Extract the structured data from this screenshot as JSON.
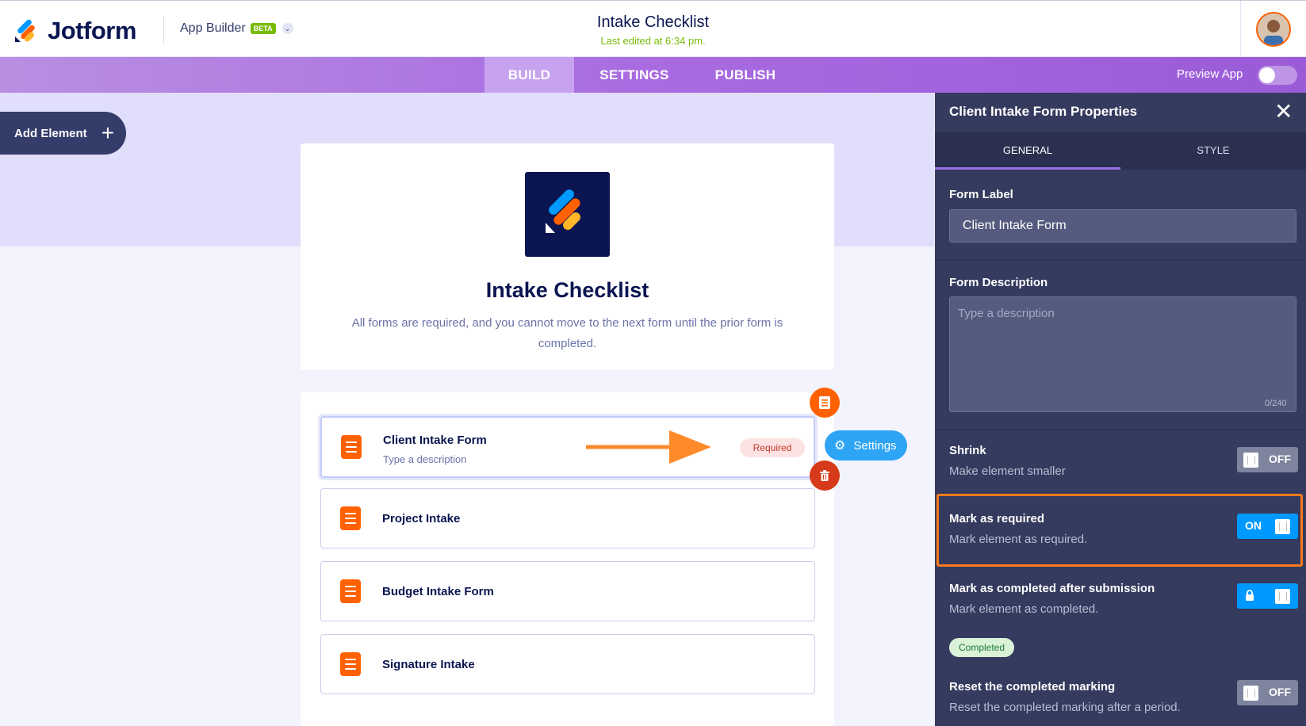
{
  "header": {
    "brand": "Jotform",
    "app_builder": "App Builder",
    "beta": "BETA",
    "title": "Intake Checklist",
    "last_edited": "Last edited at 6:34 pm."
  },
  "nav": {
    "tabs": [
      "BUILD",
      "SETTINGS",
      "PUBLISH"
    ],
    "active_tab": "BUILD",
    "preview_label": "Preview App",
    "preview_on": false
  },
  "canvas": {
    "add_element": "Add Element",
    "app_title": "Intake Checklist",
    "app_description": "All forms are required, and you cannot move to the next form until the prior form is completed.",
    "items": [
      {
        "label": "Client Intake Form",
        "description": "Type a description",
        "badge": "Required",
        "selected": true
      },
      {
        "label": "Project Intake"
      },
      {
        "label": "Budget Intake Form"
      },
      {
        "label": "Signature Intake"
      }
    ],
    "settings_button": "Settings"
  },
  "panel": {
    "title": "Client Intake Form Properties",
    "tabs": [
      "GENERAL",
      "STYLE"
    ],
    "active_tab": "GENERAL",
    "form_label": {
      "title": "Form Label",
      "value": "Client Intake Form"
    },
    "form_description": {
      "title": "Form Description",
      "placeholder": "Type a description",
      "counter": "0/240"
    },
    "shrink": {
      "title": "Shrink",
      "desc": "Make element smaller",
      "state": "OFF"
    },
    "mark_required": {
      "title": "Mark as required",
      "desc": "Mark element as required.",
      "state": "ON"
    },
    "mark_completed": {
      "title": "Mark as completed after submission",
      "desc": "Mark element as completed.",
      "badge": "Completed"
    },
    "reset_completed": {
      "title": "Reset the completed marking",
      "desc": "Reset the completed marking after a period.",
      "state": "OFF"
    }
  },
  "colors": {
    "brand_orange": "#ff6100",
    "nav_purple": "#a86be0",
    "panel_bg": "#353b5e",
    "toggle_on": "#0099ff",
    "highlight": "#ff7a1a"
  }
}
